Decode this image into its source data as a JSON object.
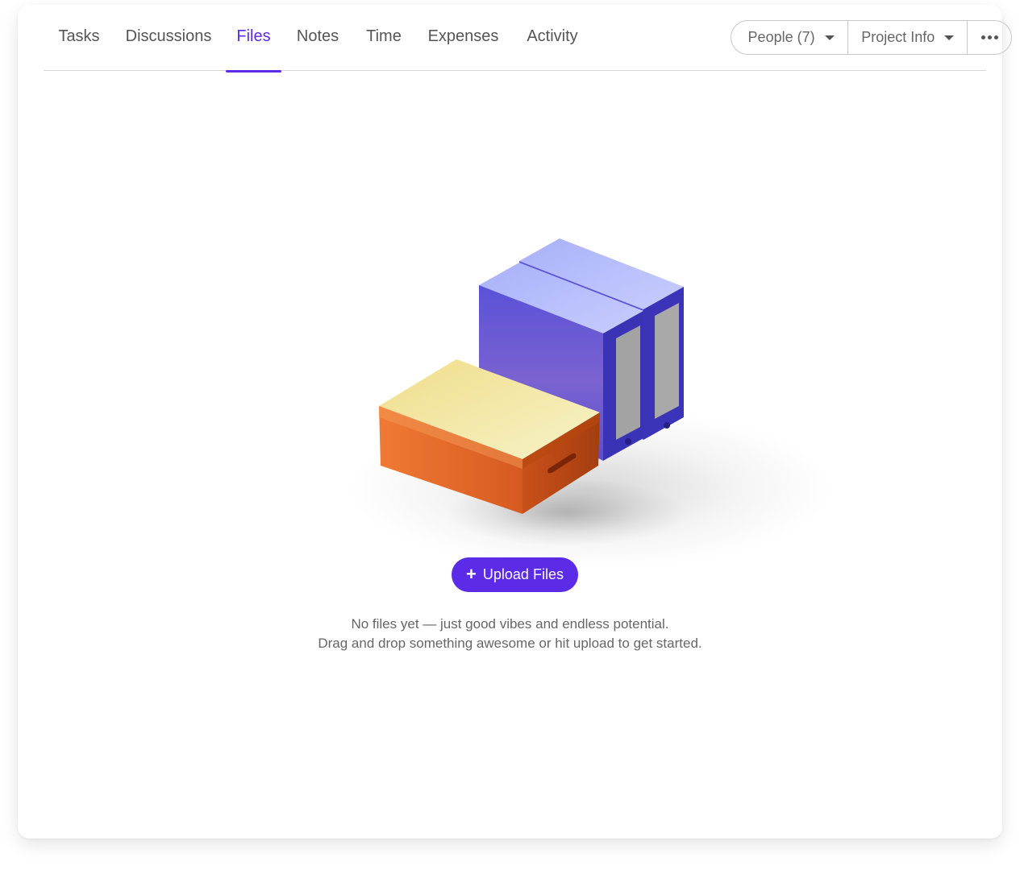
{
  "tabs": [
    {
      "label": "Tasks",
      "active": false
    },
    {
      "label": "Discussions",
      "active": false
    },
    {
      "label": "Files",
      "active": true
    },
    {
      "label": "Notes",
      "active": false
    },
    {
      "label": "Time",
      "active": false
    },
    {
      "label": "Expenses",
      "active": false
    },
    {
      "label": "Activity",
      "active": false
    }
  ],
  "header_actions": {
    "people_label": "People (7)",
    "project_info_label": "Project Info",
    "more_icon": "ellipsis-icon"
  },
  "empty_state": {
    "illustration": "file-boxes-illustration",
    "upload_label": "Upload Files",
    "upload_icon": "plus-icon",
    "line1": "No files yet — just good vibes and endless potential.",
    "line2": "Drag and drop something awesome or hit upload to get started."
  },
  "colors": {
    "accent": "#5b2be8",
    "binder": "#6a5fe0",
    "box": "#e86a2c",
    "box_lid": "#f3e9a0"
  }
}
